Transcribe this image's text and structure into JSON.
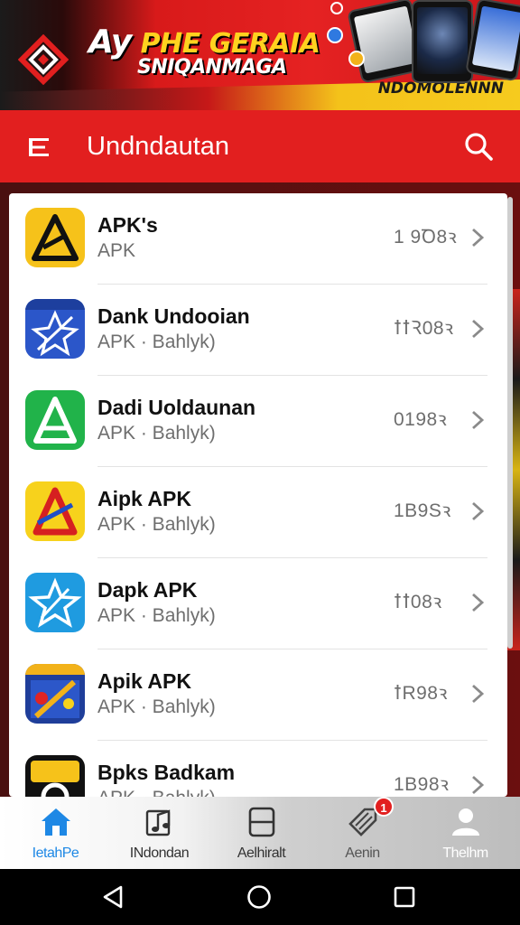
{
  "banner": {
    "prefix": "Ay",
    "line1": "PHE GERAIA",
    "line2": "SNIQANMAGA",
    "tag": "NDOMOLENNN",
    "colors": {
      "red": "#e21f1f",
      "yellow": "#ffd21f"
    }
  },
  "header": {
    "title": "Undndautan",
    "menu_icon": "menu-icon",
    "search_icon": "search-icon"
  },
  "apps": [
    {
      "title": "APK's",
      "subtitle": "APK",
      "size": "1 9Ꝺ8ꝛ",
      "icon": "triangle-a-icon",
      "icon_bg": "#f6c21a"
    },
    {
      "title": "Dank Undooian",
      "subtitle": "APK · Bahlyk)",
      "size": "ꝉꝉꝚ08ꝛ",
      "icon": "star-x-icon",
      "icon_bg": "#2b56c9"
    },
    {
      "title": "Dadi Uoldaunan",
      "subtitle": "APK · Bahlyk)",
      "size": "0198ꝛ",
      "icon": "green-a-icon",
      "icon_bg": "#21b34a"
    },
    {
      "title": "Aipk APK",
      "subtitle": "APK · Bahlyk)",
      "size": "1B9Sꝛ",
      "icon": "red-a-icon",
      "icon_bg": "#f7d21c"
    },
    {
      "title": "Dapk APK",
      "subtitle": "APK · Bahlyk)",
      "size": "ꝉꝉ08ꝛ",
      "icon": "blue-star-icon",
      "icon_bg": "#1f9be0"
    },
    {
      "title": "Apik APK",
      "subtitle": "APK · Bahlyk)",
      "size": "ꝉR98ꝛ",
      "icon": "game-icon",
      "icon_bg": "#1f3e9a"
    },
    {
      "title": "Bpks Badkam",
      "subtitle": "APK · Bahlyk)",
      "size": "1B98ꝛ",
      "icon": "apk-black-icon",
      "icon_bg": "#111111"
    }
  ],
  "nav": [
    {
      "label": "IetahPe",
      "icon": "home-icon",
      "active": true
    },
    {
      "label": "INdondan",
      "icon": "music-icon",
      "active": false
    },
    {
      "label": "Aelhiralt",
      "icon": "tablet-icon",
      "active": false
    },
    {
      "label": "Aenin",
      "icon": "tag-icon",
      "active": false,
      "badge": "1"
    },
    {
      "label": "Thelhm",
      "icon": "profile-icon",
      "active": false
    }
  ],
  "system_nav": {
    "back": "back-icon",
    "home": "home-circle-icon",
    "recents": "recents-icon"
  }
}
